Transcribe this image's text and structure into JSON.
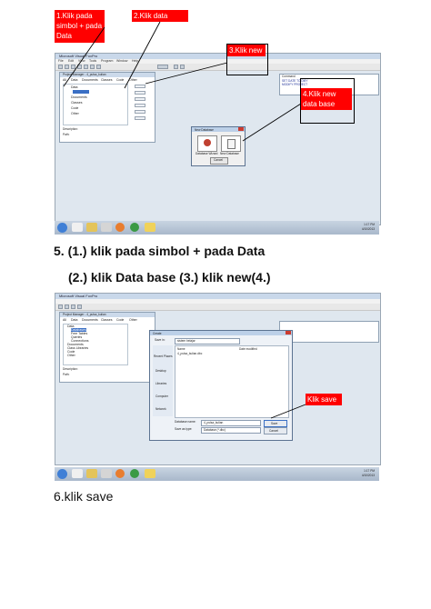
{
  "callouts": {
    "c1": "1.Klik pada simbol + pada Data",
    "c2": "2.Klik data base.",
    "c3": "3.Klik new",
    "c4": "4.Klik new data base",
    "c6": "Klik save"
  },
  "shot1": {
    "window_title": "Microsoft Visual FoxPro",
    "menu": [
      "File",
      "Edit",
      "View",
      "Tools",
      "Program",
      "Window",
      "Help"
    ],
    "pm_title": "Project Manager - 4_pulsa_kulian",
    "tabs": [
      "All",
      "Data",
      "Documents",
      "Classes",
      "Code",
      "Other"
    ],
    "tree": [
      "Data",
      "Documents",
      "Classes",
      "Code",
      "Other"
    ],
    "buttons": [
      "New...",
      "Add...",
      "Modify",
      "Run",
      "Remove",
      "Build..."
    ],
    "desc_label": "Description:",
    "path_label": "Path:",
    "cmd_title": "Command",
    "cmd_lines": [
      "SET DATE TO DMY",
      "MODIFY PROJECT"
    ],
    "newdb_title": "New Database",
    "newdb_btn1": "Database Wizard",
    "newdb_btn2": "New Database",
    "newdb_cancel": "Cancel"
  },
  "heading5": {
    "line1": "5. (1.) klik pada simbol + pada Data",
    "line2": "(2.) klik Data base (3.) klik new(4.)"
  },
  "shot2": {
    "window_title": "Microsoft Visual FoxPro",
    "pm_title": "Project Manager - 4_pulsa_kulian",
    "tabs": [
      "All",
      "Data",
      "Documents",
      "Classes",
      "Code",
      "Other"
    ],
    "tree": [
      "Data",
      "Databases",
      "Free Tables",
      "Queries",
      "Connections",
      "Documents",
      "Class Libraries",
      "Code",
      "Other"
    ],
    "desc_label": "Description:",
    "path_label": "Path:",
    "create_title": "Create",
    "save_in_label": "Save in:",
    "save_in_value": "sistem belajar",
    "col_name": "Name",
    "col_date": "Date modified",
    "file_row": "4_pulsa_kulian.dbc",
    "places": [
      "Recent Places",
      "Desktop",
      "Libraries",
      "Computer",
      "Network"
    ],
    "db_name_label": "Database name:",
    "db_name_value": "4_pulsa_kulian",
    "save_type_label": "Save as type:",
    "save_type_value": "Database (*.dbc)",
    "save_btn": "Save",
    "cancel_btn": "Cancel"
  },
  "taskbar": {
    "time": "1:17 PM",
    "date": "4/10/2013"
  },
  "step6": "6.klik save"
}
